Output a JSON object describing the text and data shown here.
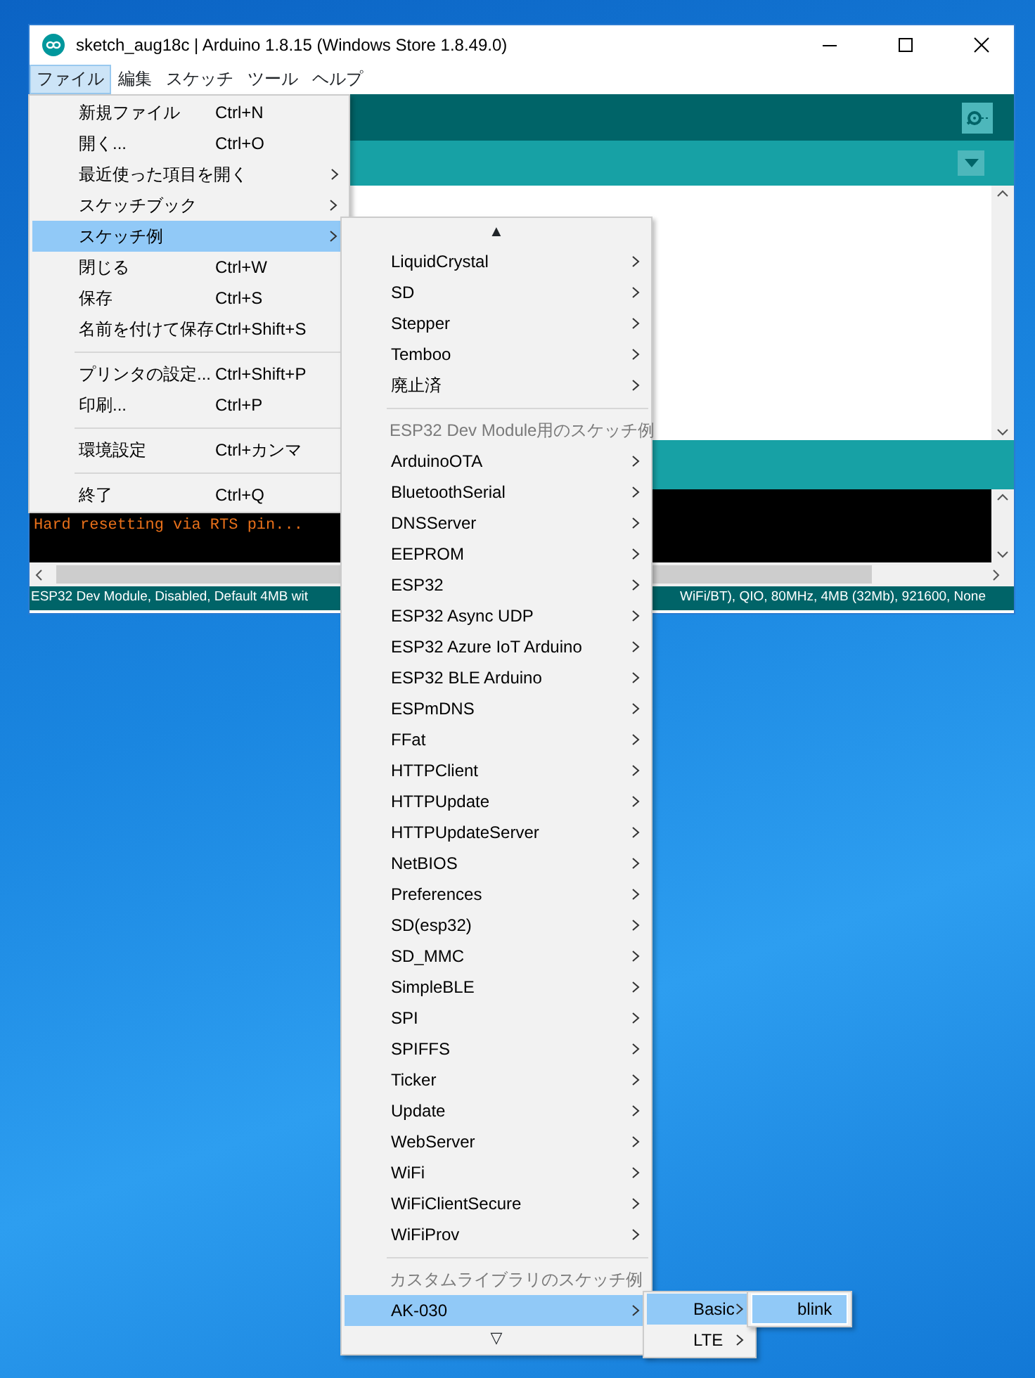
{
  "window": {
    "title": "sketch_aug18c | Arduino 1.8.15 (Windows Store 1.8.49.0)"
  },
  "menubar": [
    {
      "label": "ファイル",
      "selected": true
    },
    {
      "label": "編集",
      "selected": false
    },
    {
      "label": "スケッチ",
      "selected": false
    },
    {
      "label": "ツール",
      "selected": false
    },
    {
      "label": "ヘルプ",
      "selected": false
    }
  ],
  "file_menu": [
    {
      "kind": "item",
      "label": "新規ファイル",
      "shortcut": "Ctrl+N",
      "submenu": false,
      "selected": false
    },
    {
      "kind": "item",
      "label": "開く...",
      "shortcut": "Ctrl+O",
      "submenu": false,
      "selected": false
    },
    {
      "kind": "item",
      "label": "最近使った項目を開く",
      "submenu": true,
      "selected": false
    },
    {
      "kind": "item",
      "label": "スケッチブック",
      "submenu": true,
      "selected": false
    },
    {
      "kind": "item",
      "label": "スケッチ例",
      "submenu": true,
      "selected": true
    },
    {
      "kind": "item",
      "label": "閉じる",
      "shortcut": "Ctrl+W",
      "submenu": false,
      "selected": false
    },
    {
      "kind": "item",
      "label": "保存",
      "shortcut": "Ctrl+S",
      "submenu": false,
      "selected": false
    },
    {
      "kind": "item",
      "label": "名前を付けて保存",
      "shortcut": "Ctrl+Shift+S",
      "submenu": false,
      "selected": false
    },
    {
      "kind": "separator"
    },
    {
      "kind": "item",
      "label": "プリンタの設定...",
      "shortcut": "Ctrl+Shift+P",
      "submenu": false,
      "selected": false
    },
    {
      "kind": "item",
      "label": "印刷...",
      "shortcut": "Ctrl+P",
      "submenu": false,
      "selected": false
    },
    {
      "kind": "separator"
    },
    {
      "kind": "item",
      "label": "環境設定",
      "shortcut": "Ctrl+カンマ",
      "submenu": false,
      "selected": false
    },
    {
      "kind": "separator"
    },
    {
      "kind": "item",
      "label": "終了",
      "shortcut": "Ctrl+Q",
      "submenu": false,
      "selected": false
    }
  ],
  "examples_menu": {
    "scroll_up": "▲",
    "scroll_down": "▽",
    "items": [
      {
        "kind": "item",
        "label": "LiquidCrystal",
        "submenu": true,
        "selected": false
      },
      {
        "kind": "item",
        "label": "SD",
        "submenu": true,
        "selected": false
      },
      {
        "kind": "item",
        "label": "Stepper",
        "submenu": true,
        "selected": false
      },
      {
        "kind": "item",
        "label": "Temboo",
        "submenu": true,
        "selected": false
      },
      {
        "kind": "item",
        "label": "廃止済",
        "submenu": true,
        "selected": false
      },
      {
        "kind": "separator"
      },
      {
        "kind": "header",
        "label": "ESP32 Dev Module用のスケッチ例"
      },
      {
        "kind": "item",
        "label": "ArduinoOTA",
        "submenu": true,
        "selected": false
      },
      {
        "kind": "item",
        "label": "BluetoothSerial",
        "submenu": true,
        "selected": false
      },
      {
        "kind": "item",
        "label": "DNSServer",
        "submenu": true,
        "selected": false
      },
      {
        "kind": "item",
        "label": "EEPROM",
        "submenu": true,
        "selected": false
      },
      {
        "kind": "item",
        "label": "ESP32",
        "submenu": true,
        "selected": false
      },
      {
        "kind": "item",
        "label": "ESP32 Async UDP",
        "submenu": true,
        "selected": false
      },
      {
        "kind": "item",
        "label": "ESP32 Azure IoT Arduino",
        "submenu": true,
        "selected": false
      },
      {
        "kind": "item",
        "label": "ESP32 BLE Arduino",
        "submenu": true,
        "selected": false
      },
      {
        "kind": "item",
        "label": "ESPmDNS",
        "submenu": true,
        "selected": false
      },
      {
        "kind": "item",
        "label": "FFat",
        "submenu": true,
        "selected": false
      },
      {
        "kind": "item",
        "label": "HTTPClient",
        "submenu": true,
        "selected": false
      },
      {
        "kind": "item",
        "label": "HTTPUpdate",
        "submenu": true,
        "selected": false
      },
      {
        "kind": "item",
        "label": "HTTPUpdateServer",
        "submenu": true,
        "selected": false
      },
      {
        "kind": "item",
        "label": "NetBIOS",
        "submenu": true,
        "selected": false
      },
      {
        "kind": "item",
        "label": "Preferences",
        "submenu": true,
        "selected": false
      },
      {
        "kind": "item",
        "label": "SD(esp32)",
        "submenu": true,
        "selected": false
      },
      {
        "kind": "item",
        "label": "SD_MMC",
        "submenu": true,
        "selected": false
      },
      {
        "kind": "item",
        "label": "SimpleBLE",
        "submenu": true,
        "selected": false
      },
      {
        "kind": "item",
        "label": "SPI",
        "submenu": true,
        "selected": false
      },
      {
        "kind": "item",
        "label": "SPIFFS",
        "submenu": true,
        "selected": false
      },
      {
        "kind": "item",
        "label": "Ticker",
        "submenu": true,
        "selected": false
      },
      {
        "kind": "item",
        "label": "Update",
        "submenu": true,
        "selected": false
      },
      {
        "kind": "item",
        "label": "WebServer",
        "submenu": true,
        "selected": false
      },
      {
        "kind": "item",
        "label": "WiFi",
        "submenu": true,
        "selected": false
      },
      {
        "kind": "item",
        "label": "WiFiClientSecure",
        "submenu": true,
        "selected": false
      },
      {
        "kind": "item",
        "label": "WiFiProv",
        "submenu": true,
        "selected": false
      },
      {
        "kind": "separator"
      },
      {
        "kind": "header",
        "label": "カスタムライブラリのスケッチ例"
      },
      {
        "kind": "item",
        "label": "AK-030",
        "submenu": true,
        "selected": true
      }
    ]
  },
  "library_menu": [
    {
      "label": "Basic",
      "submenu": true,
      "selected": true
    },
    {
      "label": "LTE",
      "submenu": true,
      "selected": false
    }
  ],
  "sketch_menu": [
    {
      "label": "blink",
      "submenu": false,
      "selected": true
    }
  ],
  "console": {
    "text": "Hard resetting via RTS pin..."
  },
  "status_bar": {
    "left": "ESP32 Dev Module, Disabled, Default 4MB wit",
    "right": "WiFi/BT), QIO, 80MHz, 4MB (32Mb), 921600, None"
  }
}
